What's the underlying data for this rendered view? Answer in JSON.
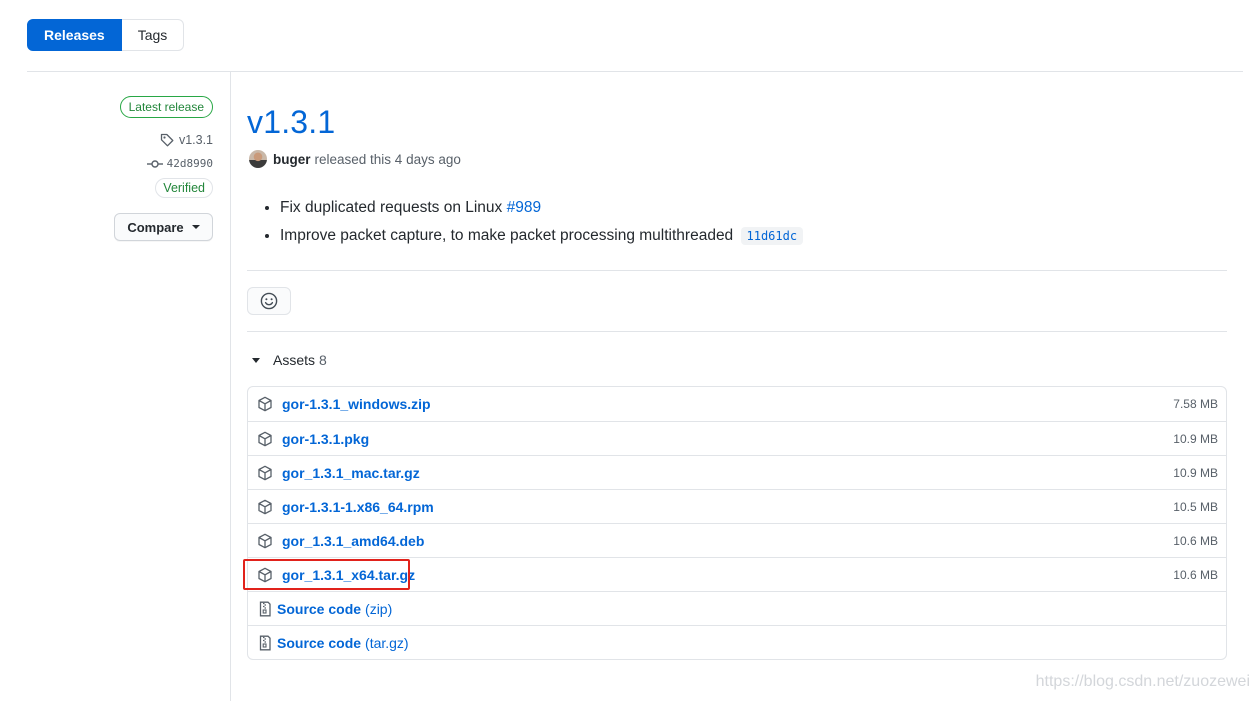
{
  "tabs": {
    "releases": "Releases",
    "tags": "Tags"
  },
  "sidebar": {
    "latest_badge": "Latest release",
    "tag": "v1.3.1",
    "commit": "42d8990",
    "verified": "Verified",
    "compare": "Compare"
  },
  "release": {
    "title": "v1.3.1",
    "author": "buger",
    "released_text": "released this 4 days ago",
    "notes": [
      {
        "text": "Fix duplicated requests on Linux",
        "link": "#989"
      },
      {
        "text": "Improve packet capture, to make packet processing multithreaded",
        "code": "11d61dc"
      }
    ]
  },
  "assets": {
    "label": "Assets",
    "count": "8",
    "files": [
      {
        "name": "gor-1.3.1_windows.zip",
        "size": "7.58 MB"
      },
      {
        "name": "gor-1.3.1.pkg",
        "size": "10.9 MB"
      },
      {
        "name": "gor_1.3.1_mac.tar.gz",
        "size": "10.9 MB"
      },
      {
        "name": "gor-1.3.1-1.x86_64.rpm",
        "size": "10.5 MB"
      },
      {
        "name": "gor_1.3.1_amd64.deb",
        "size": "10.6 MB"
      },
      {
        "name": "gor_1.3.1_x64.tar.gz",
        "size": "10.6 MB"
      }
    ],
    "source": [
      {
        "label": "Source code",
        "type": "(zip)"
      },
      {
        "label": "Source code",
        "type": "(tar.gz)"
      }
    ]
  },
  "watermark": "https://blog.csdn.net/zuozewei",
  "colors": {
    "accent": "#0366d6",
    "success": "#28a745",
    "highlight": "#e1221b"
  },
  "icons": [
    "tag-icon",
    "commit-icon",
    "smiley-icon",
    "package-icon",
    "file-zip-icon"
  ]
}
